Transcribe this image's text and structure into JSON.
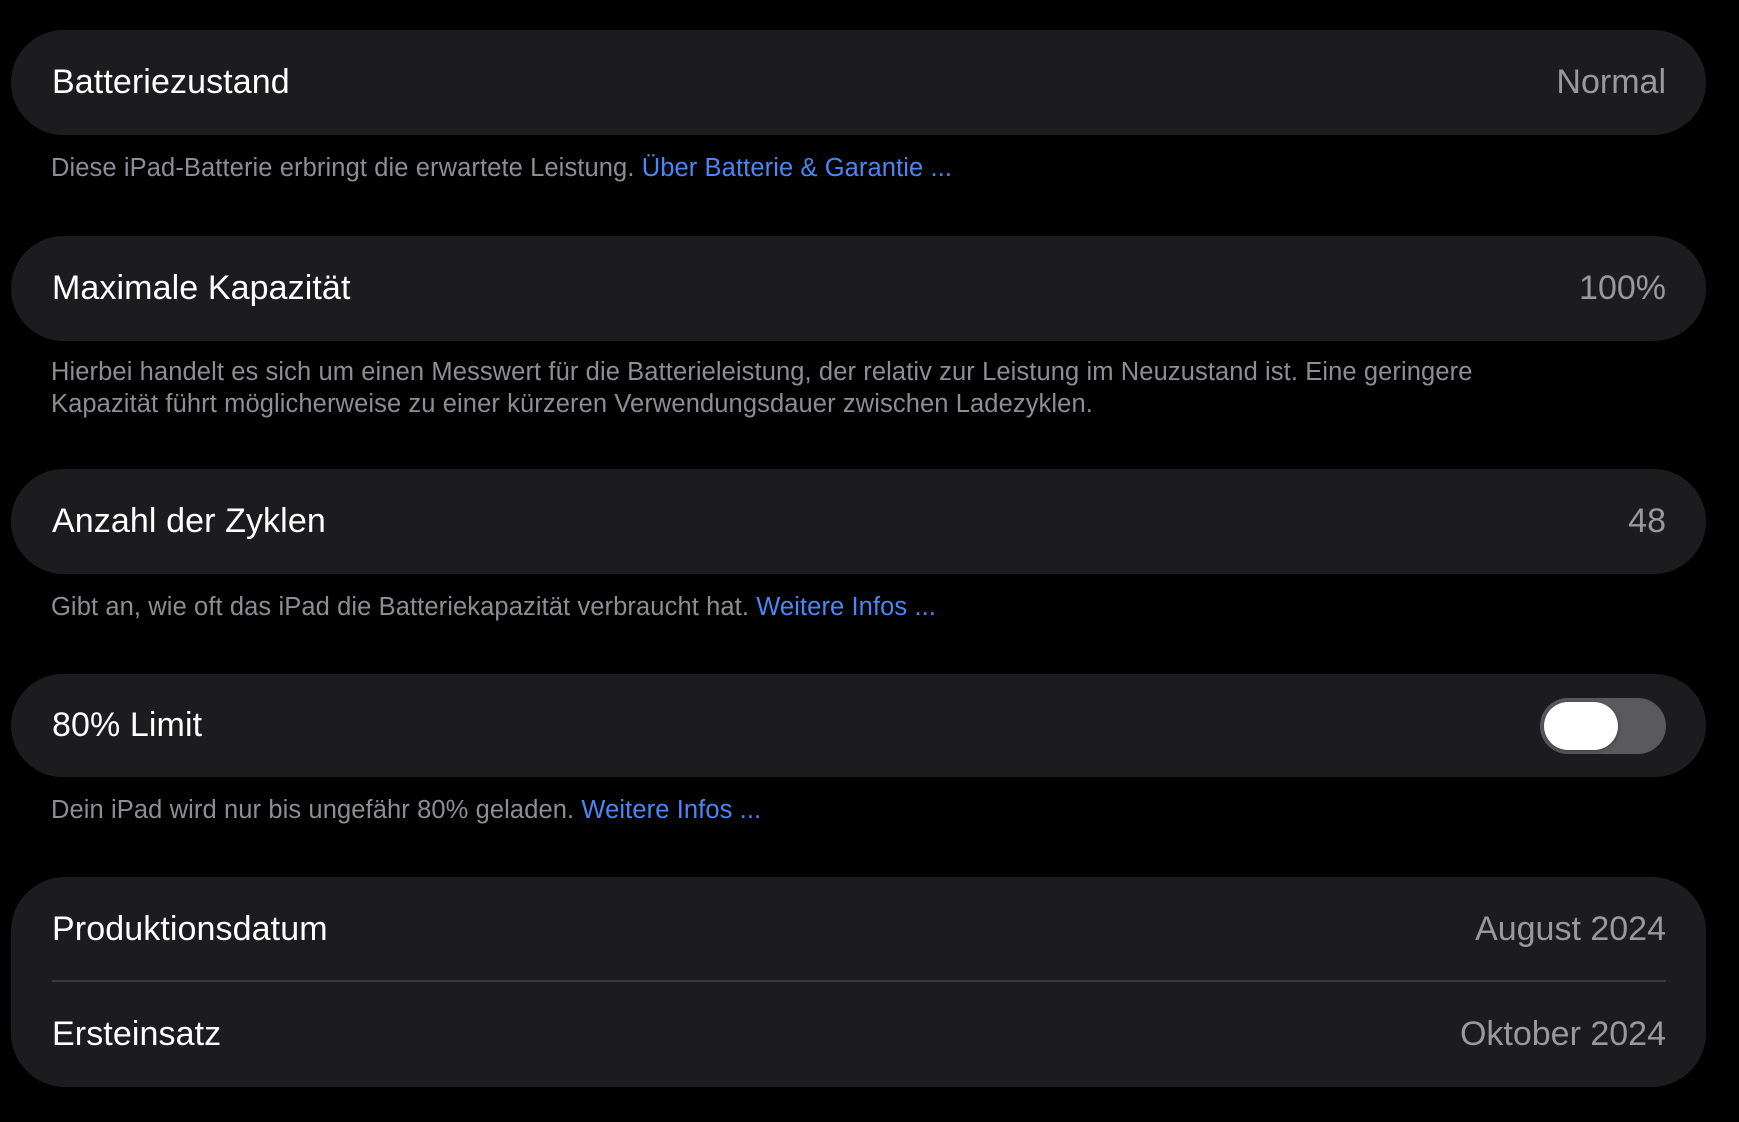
{
  "battery_health": {
    "label": "Batteriezustand",
    "value": "Normal",
    "footer_text": "Diese iPad-Batterie erbringt die erwartete Leistung. ",
    "footer_link": "Über Batterie & Garantie ..."
  },
  "max_capacity": {
    "label": "Maximale Kapazität",
    "value": "100%",
    "footer_text_line1": "Hierbei handelt es sich um einen Messwert für die Batterieleistung, der relativ zur Leistung im Neuzustand ist. Eine geringere",
    "footer_text_line2": "Kapazität führt möglicherweise zu einer kürzeren Verwendungsdauer zwischen Ladezyklen."
  },
  "cycle_count": {
    "label": "Anzahl der Zyklen",
    "value": "48",
    "footer_text": "Gibt an, wie oft das iPad die Batteriekapazität verbraucht hat. ",
    "footer_link": "Weitere Infos ..."
  },
  "limit_80": {
    "label": "80% Limit",
    "toggle_on": false,
    "footer_text": "Dein iPad wird nur bis ungefähr 80% geladen. ",
    "footer_link": "Weitere Infos ..."
  },
  "dates": {
    "production_label": "Produktionsdatum",
    "production_value": "August 2024",
    "first_use_label": "Ersteinsatz",
    "first_use_value": "Oktober 2024"
  },
  "colors": {
    "background": "#000000",
    "cell": "#1c1c1e",
    "link": "#4a86f5",
    "secondary_text": "#8d8d93",
    "toggle_off": "#5a5a5e"
  }
}
